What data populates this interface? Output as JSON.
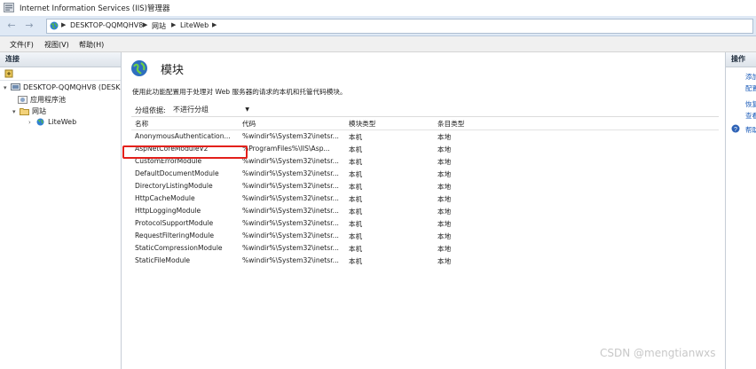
{
  "window": {
    "title": "Internet Information Services (IIS)管理器"
  },
  "address": {
    "crumbs": [
      "DESKTOP-QQMQHV8",
      "网站",
      "LiteWeb"
    ]
  },
  "menu": {
    "items": [
      "文件(F)",
      "视图(V)",
      "帮助(H)"
    ]
  },
  "connections": {
    "header": "连接",
    "tree": [
      {
        "label": "DESKTOP-QQMQHV8 (DESK",
        "level": 0,
        "expanded": true
      },
      {
        "label": "应用程序池",
        "level": 1
      },
      {
        "label": "网站",
        "level": 1,
        "expanded": true
      },
      {
        "label": "LiteWeb",
        "level": 2,
        "selected": true
      }
    ]
  },
  "main": {
    "title": "模块",
    "description": "使用此功能配置用于处理对 Web 服务器的请求的本机和托管代码模块。",
    "group_by_label": "分组依据:",
    "group_by_value": "不进行分组",
    "columns": [
      "名称",
      "代码",
      "模块类型",
      "条目类型"
    ],
    "rows": [
      [
        "AnonymousAuthentication...",
        "%windir%\\System32\\inetsr...",
        "本机",
        "本地"
      ],
      [
        "AspNetCoreModuleV2",
        "%ProgramFiles%\\IIS\\Asp...",
        "本机",
        "本地"
      ],
      [
        "CustomErrorModule",
        "%windir%\\System32\\inetsr...",
        "本机",
        "本地"
      ],
      [
        "DefaultDocumentModule",
        "%windir%\\System32\\inetsr...",
        "本机",
        "本地"
      ],
      [
        "DirectoryListingModule",
        "%windir%\\System32\\inetsr...",
        "本机",
        "本地"
      ],
      [
        "HttpCacheModule",
        "%windir%\\System32\\inetsr...",
        "本机",
        "本地"
      ],
      [
        "HttpLoggingModule",
        "%windir%\\System32\\inetsr...",
        "本机",
        "本地"
      ],
      [
        "ProtocolSupportModule",
        "%windir%\\System32\\inetsr...",
        "本机",
        "本地"
      ],
      [
        "RequestFilteringModule",
        "%windir%\\System32\\inetsr...",
        "本机",
        "本地"
      ],
      [
        "StaticCompressionModule",
        "%windir%\\System32\\inetsr...",
        "本机",
        "本地"
      ],
      [
        "StaticFileModule",
        "%windir%\\System32\\inetsr...",
        "本机",
        "本地"
      ]
    ],
    "highlight_row": 1
  },
  "actions": {
    "header": "操作",
    "items": [
      "添加",
      "配置",
      "恢复",
      "查看",
      "帮助"
    ]
  },
  "watermark": "CSDN @mengtianwxs",
  "colors": {
    "highlight": "#e3201b",
    "link": "#1b5bb8"
  }
}
